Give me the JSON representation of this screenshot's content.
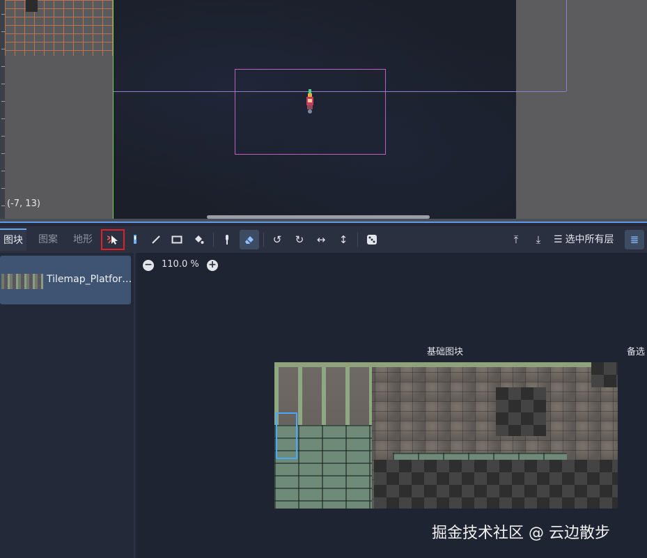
{
  "viewport": {
    "coordinate_readout": "(-7, 13)"
  },
  "toolbar": {
    "tabs": [
      {
        "label": "图块",
        "active": true
      },
      {
        "label": "图案",
        "active": false
      },
      {
        "label": "地形",
        "active": false
      }
    ],
    "tools": [
      {
        "icon": "select-cursor-icon",
        "highlighted": true
      },
      {
        "icon": "paint-brush-icon",
        "pressed": false
      },
      {
        "icon": "line-icon"
      },
      {
        "icon": "rectangle-icon"
      },
      {
        "icon": "bucket-fill-icon"
      },
      {
        "icon": "picker-icon"
      },
      {
        "icon": "eraser-icon",
        "pressed": true
      },
      {
        "icon": "rotate-left-icon"
      },
      {
        "icon": "rotate-right-icon"
      },
      {
        "icon": "flip-horizontal-icon"
      },
      {
        "icon": "flip-vertical-icon"
      },
      {
        "icon": "random-dice-icon"
      },
      {
        "icon": "layer-up-icon"
      },
      {
        "icon": "layer-down-icon"
      }
    ],
    "select_all_layers_label": "选中所有层",
    "accent_color": "#5c9de6",
    "highlight_color": "#e21f26"
  },
  "sources": {
    "items": [
      {
        "name": "Tilemap_Platfor…",
        "selected": true
      }
    ]
  },
  "atlas": {
    "zoom_label": "110.0 %",
    "zoom_out_symbol": "−",
    "zoom_in_symbol": "+",
    "base_tiles_label": "基础图块",
    "alternative_tiles_label": "备选"
  },
  "watermark": "掘金技术社区 @ 云边散步"
}
